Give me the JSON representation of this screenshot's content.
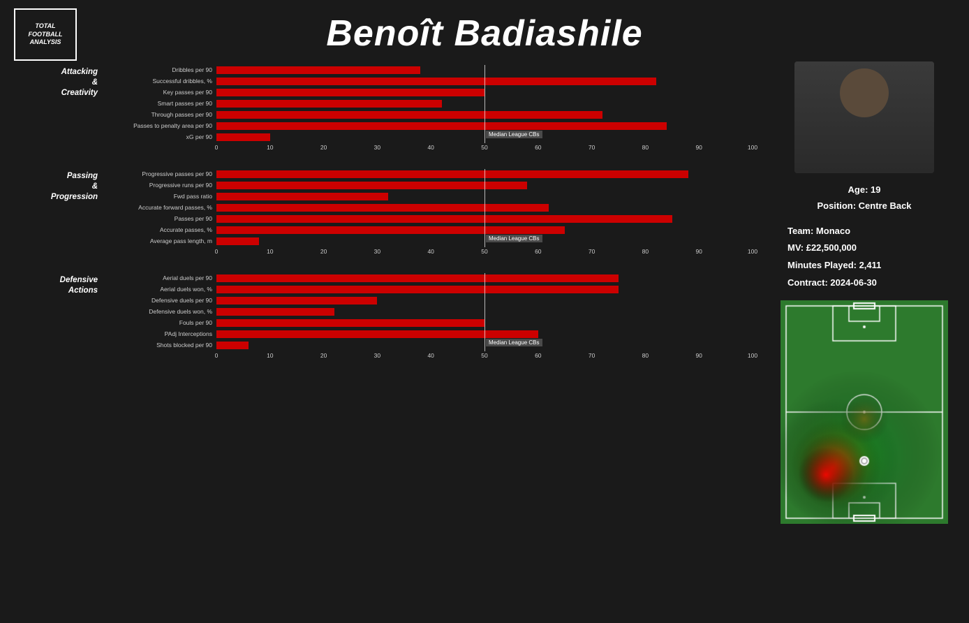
{
  "logo": {
    "text": "TOTAL\nFOOTBALL\nANALYSIS"
  },
  "player": {
    "name": "Benoît Badiashile",
    "ageLabel": "Age: 19",
    "positionLabel": "Position: Centre Back",
    "teamLabel": "Team: Monaco",
    "mvLabel": "MV: £22,500,000",
    "minutesLabel": "Minutes Played: 2,411",
    "contractLabel": "Contract: 2024-06-30"
  },
  "sections": {
    "attacking": {
      "label": "Attacking\n&\nCreativity",
      "medianPct": 50,
      "bars": [
        {
          "label": "Dribbles per 90",
          "value": 38
        },
        {
          "label": "Successful dribbles, %",
          "value": 82
        },
        {
          "label": "Key passes per 90",
          "value": 50
        },
        {
          "label": "Smart passes per 90",
          "value": 42
        },
        {
          "label": "Through passes per 90",
          "value": 72
        },
        {
          "label": "Passes to penalty area per 90",
          "value": 84
        },
        {
          "label": "xG per 90",
          "value": 10
        }
      ]
    },
    "passing": {
      "label": "Passing\n&\nProgression",
      "medianPct": 50,
      "bars": [
        {
          "label": "Progressive passes per 90",
          "value": 88
        },
        {
          "label": "Progressive runs per 90",
          "value": 58
        },
        {
          "label": "Fwd pass ratio",
          "value": 32
        },
        {
          "label": "Accurate forward passes, %",
          "value": 62
        },
        {
          "label": "Passes per 90",
          "value": 85
        },
        {
          "label": "Accurate passes, %",
          "value": 65
        },
        {
          "label": "Average pass length, m",
          "value": 8
        }
      ]
    },
    "defensive": {
      "label": "Defensive\nActions",
      "medianPct": 50,
      "bars": [
        {
          "label": "Aerial duels per 90",
          "value": 75
        },
        {
          "label": "Aerial duels won, %",
          "value": 75
        },
        {
          "label": "Defensive duels per 90",
          "value": 30
        },
        {
          "label": "Defensive duels won, %",
          "value": 22
        },
        {
          "label": "Fouls per 90",
          "value": 50
        },
        {
          "label": "PAdj Interceptions",
          "value": 60
        },
        {
          "label": "Shots blocked per 90",
          "value": 6
        }
      ]
    }
  },
  "axisMax": 100,
  "axisTicks": [
    0,
    10,
    20,
    30,
    40,
    50,
    60,
    70,
    80,
    90,
    100
  ]
}
